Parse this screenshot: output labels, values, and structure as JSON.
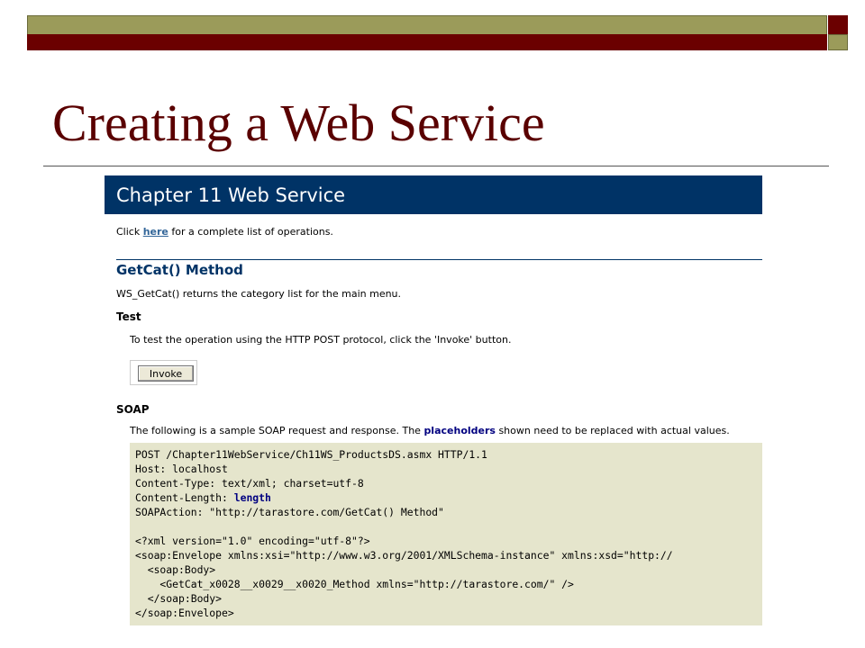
{
  "slide": {
    "title": "Creating a Web Service"
  },
  "web": {
    "header_title": "Chapter 11 Web Service",
    "intro": {
      "before": "Click ",
      "link": "here",
      "after": " for a complete list of operations."
    },
    "method_title": "GetCat() Method",
    "method_desc": "WS_GetCat() returns the category list for the main menu.",
    "test_heading": "Test",
    "test_desc": "To test the operation using the HTTP POST protocol, click the 'Invoke' button.",
    "invoke_label": "Invoke",
    "soap_heading": "SOAP",
    "soap_desc": {
      "before": "The following is a sample SOAP request and response. The ",
      "strong": "placeholders",
      "after": " shown need to be replaced with actual values."
    },
    "code": {
      "line1": "POST /Chapter11WebService/Ch11WS_ProductsDS.asmx HTTP/1.1",
      "line2": "Host: localhost",
      "line3": "Content-Type: text/xml; charset=utf-8",
      "line4_prefix": "Content-Length: ",
      "line4_value": "length",
      "line5": "SOAPAction: \"http://tarastore.com/GetCat() Method\"",
      "line6": "<?xml version=\"1.0\" encoding=\"utf-8\"?>",
      "line7": "<soap:Envelope xmlns:xsi=\"http://www.w3.org/2001/XMLSchema-instance\" xmlns:xsd=\"http://",
      "line8": "  <soap:Body>",
      "line9": "    <GetCat_x0028__x0029__x0020_Method xmlns=\"http://tarastore.com/\" />",
      "line10": "  </soap:Body>",
      "line11": "</soap:Envelope>"
    }
  },
  "colors": {
    "title": "#5a0000",
    "bar_olive": "#9b9b5a",
    "bar_red": "#6b0000",
    "header_bg": "#003366",
    "code_bg": "#e5e5cc"
  }
}
